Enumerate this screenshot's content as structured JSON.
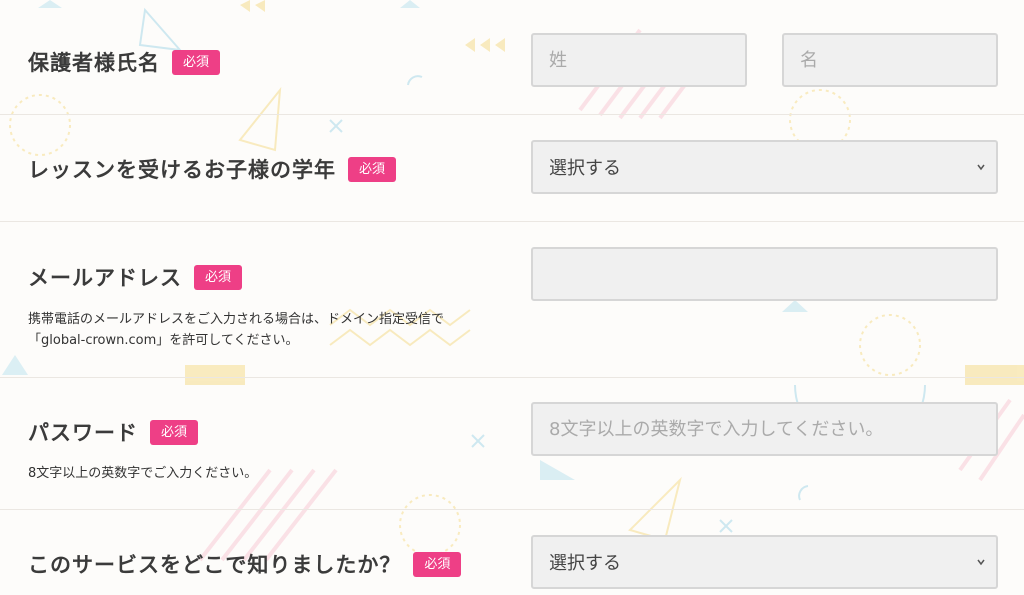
{
  "form": {
    "required_label": "必須",
    "guardian_name": {
      "label": "保護者様氏名",
      "last_placeholder": "姓",
      "first_placeholder": "名"
    },
    "grade": {
      "label": "レッスンを受けるお子様の学年",
      "selected": "選択する"
    },
    "email": {
      "label": "メールアドレス",
      "note_line1": "携帯電話のメールアドレスをご入力される場合は、ドメイン指定受信で",
      "note_line2": "「global-crown.com」を許可してください。"
    },
    "password": {
      "label": "パスワード",
      "placeholder": "8文字以上の英数字で入力してください。",
      "note": "8文字以上の英数字でご入力ください。"
    },
    "source": {
      "label": "このサービスをどこで知りましたか？",
      "selected": "選択する"
    }
  },
  "colors": {
    "badge": "#ee3f86",
    "field_bg": "#f0f0f0",
    "field_border": "#d6d6d6",
    "decor_yellow": "#f7e3a6",
    "decor_blue": "#bfe3ef",
    "decor_pink": "#f9d3dd"
  }
}
